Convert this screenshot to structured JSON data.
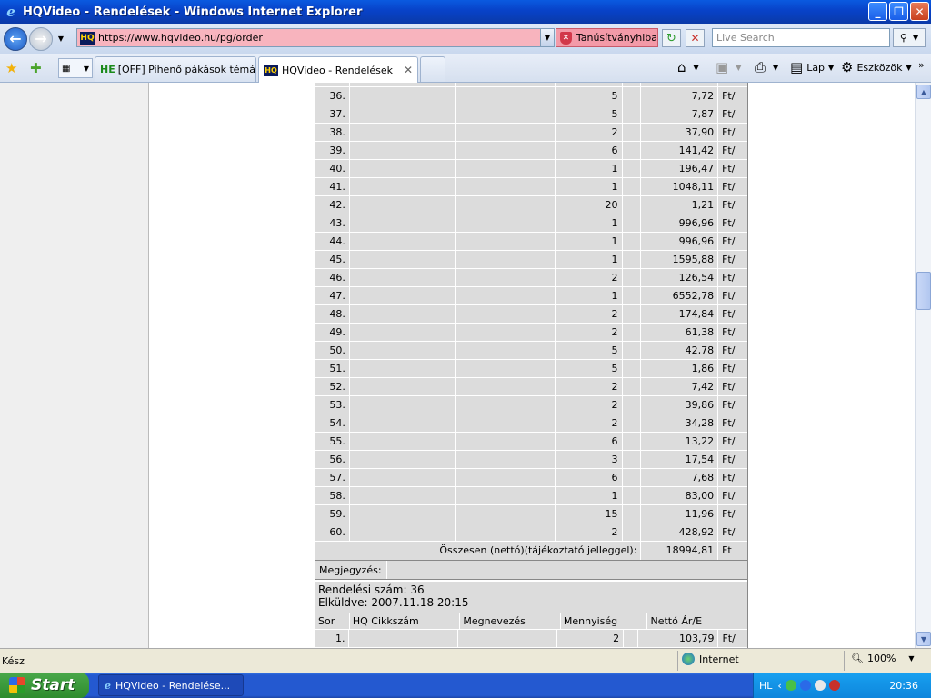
{
  "window": {
    "title": "HQVideo - Rendelések - Windows Internet Explorer"
  },
  "address": {
    "url": "https://www.hqvideo.hu/pg/order",
    "cert_error": "Tanúsítványhiba",
    "search_placeholder": "Live Search"
  },
  "tabs": [
    {
      "label": "[OFF] Pihenő pákások témáj..."
    },
    {
      "label": "HQVideo - Rendelések"
    }
  ],
  "commandbar": {
    "page": "Lap",
    "tools": "Eszközök"
  },
  "order1": {
    "rows": [
      {
        "sor": "36.",
        "menny": "5",
        "ar": "7,72",
        "ft": "Ft/"
      },
      {
        "sor": "37.",
        "menny": "5",
        "ar": "7,87",
        "ft": "Ft/"
      },
      {
        "sor": "38.",
        "menny": "2",
        "ar": "37,90",
        "ft": "Ft/"
      },
      {
        "sor": "39.",
        "menny": "6",
        "ar": "141,42",
        "ft": "Ft/"
      },
      {
        "sor": "40.",
        "menny": "1",
        "ar": "196,47",
        "ft": "Ft/"
      },
      {
        "sor": "41.",
        "menny": "1",
        "ar": "1048,11",
        "ft": "Ft/"
      },
      {
        "sor": "42.",
        "menny": "20",
        "ar": "1,21",
        "ft": "Ft/"
      },
      {
        "sor": "43.",
        "menny": "1",
        "ar": "996,96",
        "ft": "Ft/"
      },
      {
        "sor": "44.",
        "menny": "1",
        "ar": "996,96",
        "ft": "Ft/"
      },
      {
        "sor": "45.",
        "menny": "1",
        "ar": "1595,88",
        "ft": "Ft/"
      },
      {
        "sor": "46.",
        "menny": "2",
        "ar": "126,54",
        "ft": "Ft/"
      },
      {
        "sor": "47.",
        "menny": "1",
        "ar": "6552,78",
        "ft": "Ft/"
      },
      {
        "sor": "48.",
        "menny": "2",
        "ar": "174,84",
        "ft": "Ft/"
      },
      {
        "sor": "49.",
        "menny": "2",
        "ar": "61,38",
        "ft": "Ft/"
      },
      {
        "sor": "50.",
        "menny": "5",
        "ar": "42,78",
        "ft": "Ft/"
      },
      {
        "sor": "51.",
        "menny": "5",
        "ar": "1,86",
        "ft": "Ft/"
      },
      {
        "sor": "52.",
        "menny": "2",
        "ar": "7,42",
        "ft": "Ft/"
      },
      {
        "sor": "53.",
        "menny": "2",
        "ar": "39,86",
        "ft": "Ft/"
      },
      {
        "sor": "54.",
        "menny": "2",
        "ar": "34,28",
        "ft": "Ft/"
      },
      {
        "sor": "55.",
        "menny": "6",
        "ar": "13,22",
        "ft": "Ft/"
      },
      {
        "sor": "56.",
        "menny": "3",
        "ar": "17,54",
        "ft": "Ft/"
      },
      {
        "sor": "57.",
        "menny": "6",
        "ar": "7,68",
        "ft": "Ft/"
      },
      {
        "sor": "58.",
        "menny": "1",
        "ar": "83,00",
        "ft": "Ft/"
      },
      {
        "sor": "59.",
        "menny": "15",
        "ar": "11,96",
        "ft": "Ft/"
      },
      {
        "sor": "60.",
        "menny": "2",
        "ar": "428,92",
        "ft": "Ft/"
      }
    ],
    "total_label": "Összesen (nettó)(tájékoztató jelleggel):",
    "total_value": "18994,81",
    "total_currency": "Ft",
    "note_label": "Megjegyzés:"
  },
  "order2": {
    "number_line": "Rendelési szám: 36",
    "sent_line": "Elküldve: 2007.11.18 20:15",
    "headers": {
      "sor": "Sor",
      "cikk": "HQ Cikkszám",
      "nev": "Megnevezés",
      "menny": "Mennyiség",
      "ar": "Nettó Ár/E"
    },
    "first_row": {
      "sor": "1.",
      "menny": "2",
      "ar": "103,79",
      "ft": "Ft/"
    }
  },
  "status": {
    "text": "Kész",
    "zone": "Internet",
    "zoom": "100%"
  },
  "taskbar": {
    "start": "Start",
    "item": "HQVideo - Rendelése...",
    "lang": "HL",
    "clock": "20:36"
  }
}
